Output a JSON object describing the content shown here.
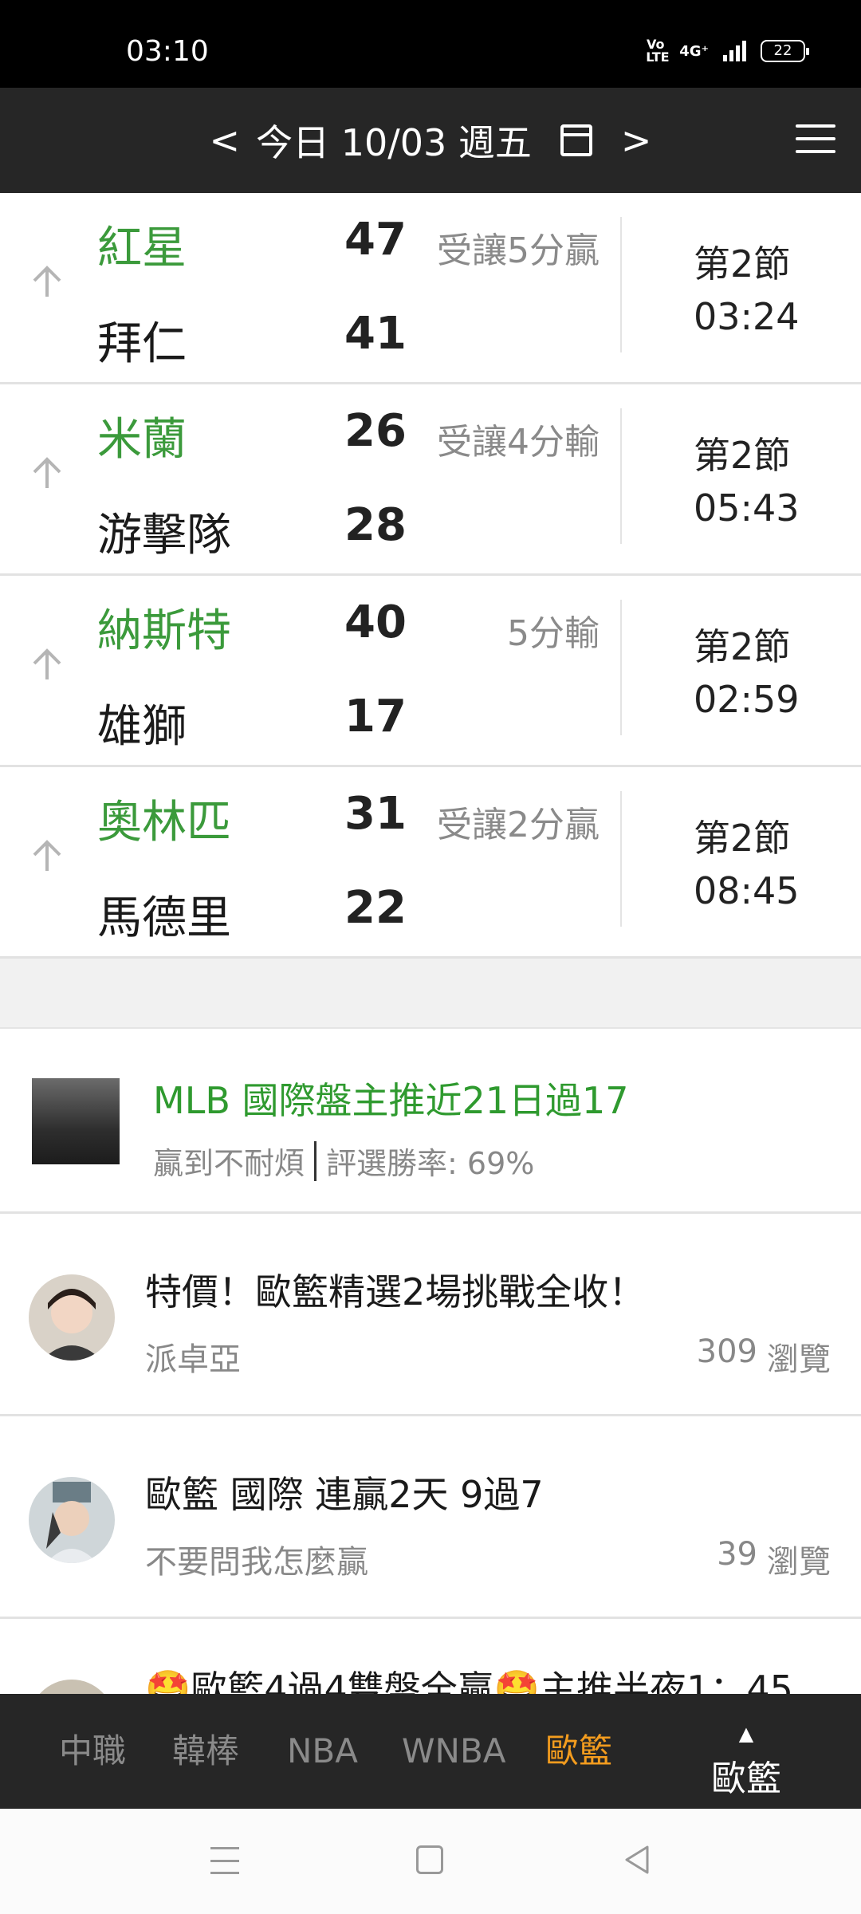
{
  "status_bar": {
    "time": "03:10",
    "volte": "Vo LTE",
    "network": "4G⁺",
    "battery": "22"
  },
  "header": {
    "prev_label": "<",
    "date_label": "今日 10/03 週五",
    "next_label": ">",
    "calendar_icon": "calendar-icon",
    "menu_icon": "hamburger-menu-icon"
  },
  "games": [
    {
      "home": "紅星",
      "home_score": "47",
      "away": "拜仁",
      "away_score": "41",
      "odds": "受讓5分贏",
      "period": "第2節",
      "clock": "03:24"
    },
    {
      "home": "米蘭",
      "home_score": "26",
      "away": "游擊隊",
      "away_score": "28",
      "odds": "受讓4分輸",
      "period": "第2節",
      "clock": "05:43"
    },
    {
      "home": "納斯特",
      "home_score": "40",
      "away": "雄獅",
      "away_score": "17",
      "odds": "5分輸",
      "period": "第2節",
      "clock": "02:59"
    },
    {
      "home": "奧林匹",
      "home_score": "31",
      "away": "馬德里",
      "away_score": "22",
      "odds": "受讓2分贏",
      "period": "第2節",
      "clock": "08:45"
    }
  ],
  "ad": {
    "title": "MLB 國際盤主推近21日過17",
    "author": "贏到不耐煩",
    "win_rate": "評選勝率: 69%"
  },
  "articles": [
    {
      "title": "特價！歐籃精選2場挑戰全收！",
      "author": "派卓亞",
      "views": "309",
      "views_label": "瀏覽"
    },
    {
      "title": "歐籃 國際 連贏2天 9過7",
      "author": "不要問我怎麼贏",
      "views": "39",
      "views_label": "瀏覽"
    },
    {
      "title": "🤩歐籃4過4雙盤全贏🤩主推半夜1：45",
      "author": "",
      "views": "",
      "views_label": ""
    }
  ],
  "tabs": [
    "中職",
    "韓棒",
    "NBA",
    "WNBA",
    "歐籃"
  ],
  "active_tab": "歐籃",
  "current_league": "歐籃",
  "colors": {
    "accent_green": "#3b9a3b",
    "active_tab": "#f39c1e",
    "header_bg": "#262626"
  }
}
